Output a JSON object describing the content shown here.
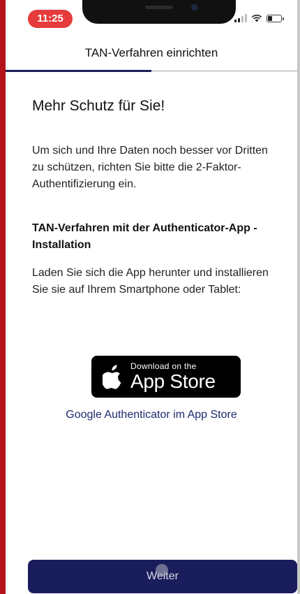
{
  "status_bar": {
    "time": "11:25",
    "icons": [
      "signal-icon",
      "wifi-icon",
      "battery-icon"
    ]
  },
  "header": {
    "title": "TAN-Verfahren einrichten",
    "progress": 0.5
  },
  "content": {
    "heading": "Mehr Schutz für Sie!",
    "intro": "Um sich und Ihre Daten noch besser vor Dritten zu schützen, richten Sie bitte die 2-Faktor-Authentifizierung ein.",
    "section_heading": "TAN-Verfahren mit der Authenticator-App - Installation",
    "install_text": "Laden Sie sich die App herunter und installieren Sie sie auf Ihrem Smartphone oder Tablet:"
  },
  "app_store_badge": {
    "small_text": "Download on the",
    "large_text": "App Store",
    "icon": "apple-icon"
  },
  "store_link": "Google Authenticator im App Store",
  "footer": {
    "button_label": "Weiter"
  },
  "colors": {
    "primary": "#1a1d5c",
    "link": "#1c2a6b",
    "time_pill": "#e63b3b",
    "frame_border": "#b5121b"
  }
}
